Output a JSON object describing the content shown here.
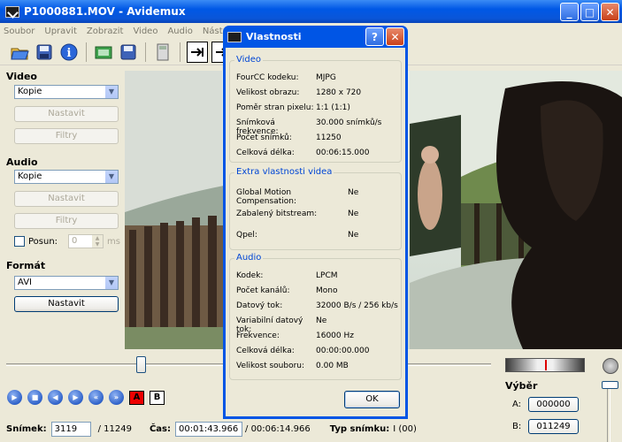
{
  "window": {
    "title": "P1000881.MOV - Avidemux"
  },
  "menu": [
    "Soubor",
    "Upravit",
    "Zobrazit",
    "Video",
    "Audio",
    "Nástro"
  ],
  "toolbar": {
    "icons": [
      "open-icon",
      "save-icon",
      "info-icon",
      "save-video-icon",
      "save-as-icon",
      "calculator-icon",
      "forward-icon",
      "forward-frame-icon"
    ]
  },
  "left": {
    "video_title": "Video",
    "video_codec": "Kopie",
    "video_configure": "Nastavit",
    "video_filters": "Filtry",
    "audio_title": "Audio",
    "audio_codec": "Kopie",
    "audio_configure": "Nastavit",
    "audio_filters": "Filtry",
    "shift_label": "Posun:",
    "shift_value": "0",
    "shift_unit": "ms",
    "format_title": "Formát",
    "format_value": "AVI",
    "format_configure": "Nastavit"
  },
  "dialog": {
    "title": "Vlastnosti",
    "video_group": "Video",
    "video_rows": [
      {
        "k": "FourCC kodeku:",
        "v": "MJPG"
      },
      {
        "k": "Velikost obrazu:",
        "v": "1280 x 720"
      },
      {
        "k": "Poměr stran pixelu:",
        "v": "1:1 (1:1)"
      },
      {
        "k": "Snímková frekvence:",
        "v": "30.000 snímků/s"
      },
      {
        "k": "Počet snímků:",
        "v": "11250"
      },
      {
        "k": "Celková délka:",
        "v": "00:06:15.000"
      }
    ],
    "extra_group": "Extra vlastnosti videa",
    "extra_rows": [
      {
        "k": "Global Motion Compensation:",
        "v": "Ne"
      },
      {
        "k": "Zabalený bitstream:",
        "v": "Ne"
      },
      {
        "k": "Qpel:",
        "v": "Ne"
      }
    ],
    "audio_group": "Audio",
    "audio_rows": [
      {
        "k": "Kodek:",
        "v": "LPCM"
      },
      {
        "k": "Počet kanálů:",
        "v": "Mono"
      },
      {
        "k": "Datový tok:",
        "v": "32000 B/s / 256 kb/s"
      },
      {
        "k": "Variabilní datový tok:",
        "v": "Ne"
      },
      {
        "k": "Frekvence:",
        "v": "16000 Hz"
      },
      {
        "k": "Celková délka:",
        "v": "00:00:00.000"
      },
      {
        "k": "Velikost souboru:",
        "v": "0.00 MB"
      }
    ],
    "ok": "OK"
  },
  "selection": {
    "title": "Výběr",
    "a_label": "A:",
    "a_value": "000000",
    "b_label": "B:",
    "b_value": "011249"
  },
  "status": {
    "frame_label": "Snímek:",
    "frame_value": "3119",
    "frame_total": "/ 11249",
    "time_label": "Čas:",
    "time_value": "00:01:43.966",
    "time_total": "/ 00:06:14.966",
    "type_label": "Typ snímku:",
    "type_value": "I (00)"
  },
  "markers": {
    "a": "A",
    "b": "B"
  }
}
